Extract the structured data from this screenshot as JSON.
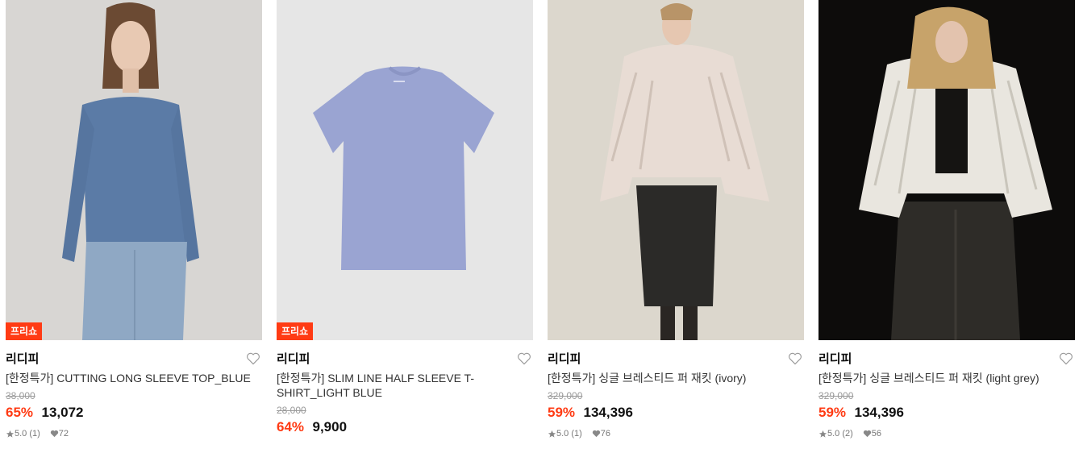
{
  "products": [
    {
      "badge": "프리쇼",
      "brand": "리디피",
      "title": "[한정특가] CUTTING LONG SLEEVE TOP_BLUE",
      "original_price": "38,000",
      "discount": "65%",
      "price": "13,072",
      "rating": "5.0 (1)",
      "likes": "72",
      "image": "model-blue-long-sleeve-top"
    },
    {
      "badge": "프리쇼",
      "brand": "리디피",
      "title": "[한정특가] SLIM LINE HALF SLEEVE T-SHIRT_LIGHT BLUE",
      "original_price": "28,000",
      "discount": "64%",
      "price": "9,900",
      "rating": "",
      "likes": "",
      "image": "light-blue-tshirt-flat"
    },
    {
      "badge": "",
      "brand": "리디피",
      "title": "[한정특가] 싱글 브레스티드 퍼 재킷 (ivory)",
      "original_price": "329,000",
      "discount": "59%",
      "price": "134,396",
      "rating": "5.0 (1)",
      "likes": "76",
      "image": "model-ivory-fur-jacket"
    },
    {
      "badge": "",
      "brand": "리디피",
      "title": "[한정특가] 싱글 브레스티드 퍼 재킷 (light grey)",
      "original_price": "329,000",
      "discount": "59%",
      "price": "134,396",
      "rating": "5.0 (2)",
      "likes": "56",
      "image": "model-light-grey-fur-jacket"
    }
  ],
  "colors": {
    "discount": "#ff3b14",
    "badge_bg": "#ff3b14"
  },
  "icons": [
    "heart-outline-icon",
    "star-icon",
    "heart-filled-icon"
  ]
}
